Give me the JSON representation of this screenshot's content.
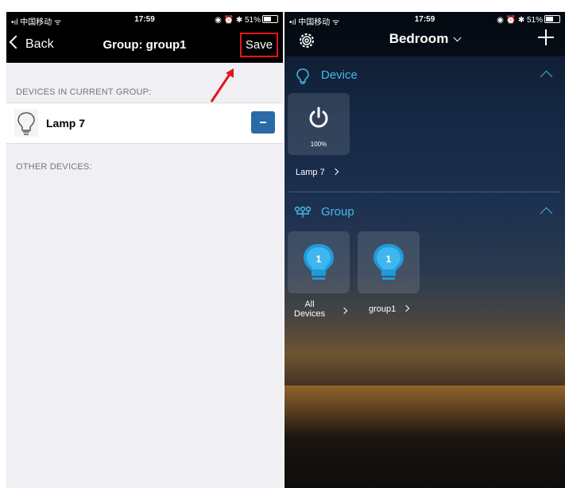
{
  "left_screen": {
    "status": {
      "carrier": "•ıl 中国移动 ᯤ",
      "time": "17:59",
      "right": "◉ ⏰ ✱ 51%"
    },
    "nav": {
      "back_label": "Back",
      "title": "Group: group1",
      "save_label": "Save"
    },
    "sections": {
      "current_header": "DEVICES IN CURRENT GROUP:",
      "current_items": [
        {
          "label": "Lamp 7"
        }
      ],
      "other_header": "OTHER DEVICES:"
    }
  },
  "right_screen": {
    "status": {
      "carrier": "•ıl 中国移动 ᯤ",
      "time": "17:59",
      "right": "◉ ⏰ ✱ 51%"
    },
    "header": {
      "room": "Bedroom"
    },
    "device_section": {
      "label": "Device",
      "tiles": [
        {
          "brightness": "100%",
          "label": "Lamp 7"
        }
      ]
    },
    "group_section": {
      "label": "Group",
      "tiles": [
        {
          "count": "1",
          "label_line1": "All",
          "label_line2": "Devices"
        },
        {
          "count": "1",
          "label": "group1"
        }
      ]
    }
  },
  "colors": {
    "accent_blue": "#4ab8e8",
    "highlight_red": "#e0161c",
    "minus_button": "#2a6aa8"
  }
}
